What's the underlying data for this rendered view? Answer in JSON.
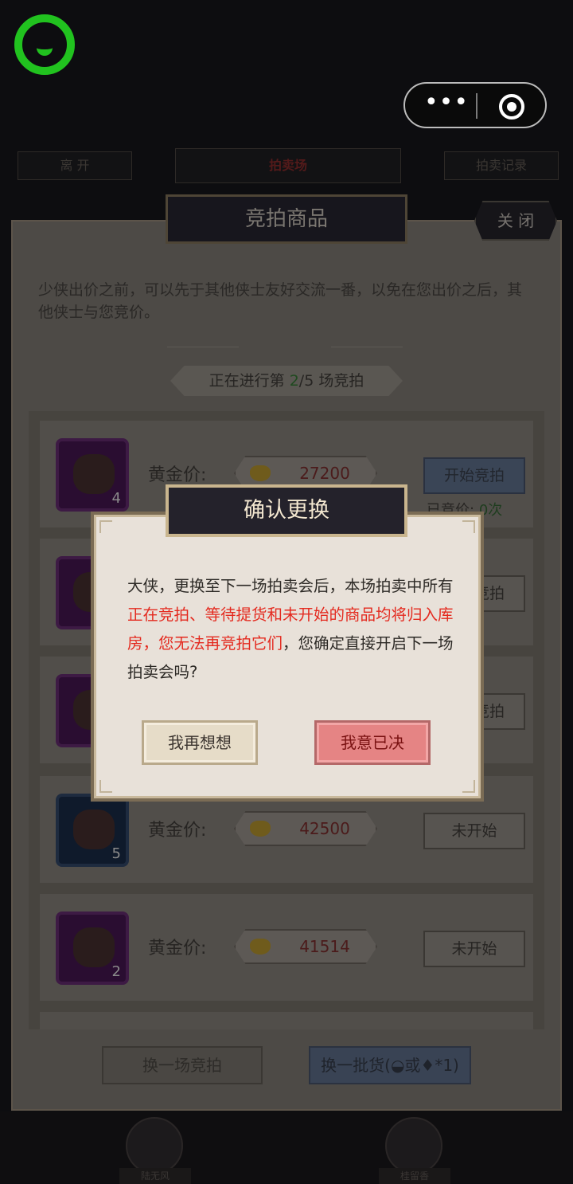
{
  "top": {
    "logo_icon": "chat-bubble-icon",
    "capsule": {
      "more_label": "•••",
      "close_icon": "target-icon"
    }
  },
  "bg_tabs": {
    "leave": "离 开",
    "center": "拍卖场",
    "record": "拍卖记录"
  },
  "panel": {
    "title": "竞拍商品",
    "close": "关 闭",
    "intro": "少侠出价之前，可以先于其他侠士友好交流一番，以免在您出价之后，其他侠士与您竞价。",
    "round": {
      "prefix": "正在进行第 ",
      "current": "2",
      "rest": "/5 场竞拍"
    }
  },
  "items": [
    {
      "qty": "4",
      "price_label": "黄金价:",
      "price": "27200",
      "status": "开始竞拍",
      "bids_label": "已竞价:",
      "bids": "0次"
    },
    {
      "qty": "",
      "price_label": "黄金价:",
      "price": "",
      "status": "开始竞拍"
    },
    {
      "qty": "",
      "price_label": "黄金价:",
      "price": "",
      "status": "开始竞拍"
    },
    {
      "qty": "5",
      "price_label": "黄金价:",
      "price": "42500",
      "status": "未开始"
    },
    {
      "qty": "2",
      "price_label": "黄金价:",
      "price": "41514",
      "status": "未开始"
    }
  ],
  "bottom": {
    "change_round": "换一场竞拍",
    "change_batch": "换一批货(",
    "or": "或",
    "times": "*1)"
  },
  "chars": [
    {
      "name": "陆无风"
    },
    {
      "name": "桂留香"
    }
  ],
  "modal": {
    "title": "确认更换",
    "text_a": "大侠，更换至下一场拍卖会后，本场拍卖中所有",
    "text_red": "正在竞拍、等待提货和未开始的商品均将归入库房，您无法再竞拍它们",
    "text_b": "，您确定直接开启下一场拍卖会吗?",
    "cancel": "我再想想",
    "confirm": "我意已决"
  },
  "colors": {
    "accent_green": "#21c21f",
    "warning_red": "#e42a1f",
    "confirm_bg": "#e58484"
  }
}
